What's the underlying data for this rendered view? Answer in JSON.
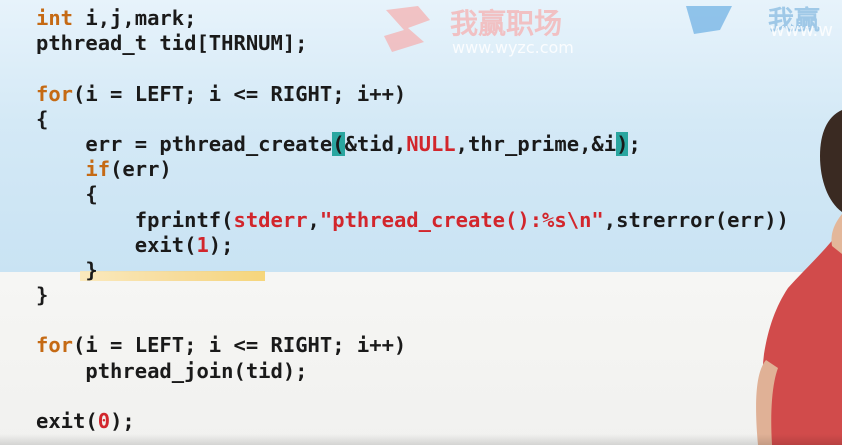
{
  "watermarks": {
    "brand_cn": "我赢职场",
    "url": "www.wyzc.com",
    "brand_cn_partial": "我赢",
    "url_partial": "www.w"
  },
  "code": {
    "lines": [
      [
        {
          "t": "int",
          "c": "kw"
        },
        {
          "t": " i,j,mark;",
          "c": "tok"
        }
      ],
      [
        {
          "t": "pthread_t tid[THRNUM];",
          "c": "tok"
        }
      ],
      [
        {
          "t": "",
          "c": "tok"
        }
      ],
      [
        {
          "t": "for",
          "c": "kw"
        },
        {
          "t": "(i = LEFT; i <= RIGHT; i++)",
          "c": "tok"
        }
      ],
      [
        {
          "t": "{",
          "c": "tok"
        }
      ],
      [
        {
          "t": "    err = pthread_create",
          "c": "tok"
        },
        {
          "t": "(",
          "c": "paren"
        },
        {
          "t": "&tid,",
          "c": "tok"
        },
        {
          "t": "NULL",
          "c": "red"
        },
        {
          "t": ",thr_prime,&i",
          "c": "tok"
        },
        {
          "t": ")",
          "c": "paren"
        },
        {
          "t": ";",
          "c": "tok"
        }
      ],
      [
        {
          "t": "    ",
          "c": "tok"
        },
        {
          "t": "if",
          "c": "kw"
        },
        {
          "t": "(err)",
          "c": "tok"
        }
      ],
      [
        {
          "t": "    {",
          "c": "tok"
        }
      ],
      [
        {
          "t": "        fprintf(",
          "c": "tok"
        },
        {
          "t": "stderr",
          "c": "red"
        },
        {
          "t": ",",
          "c": "tok"
        },
        {
          "t": "\"pthread_create():%s\\n\"",
          "c": "red"
        },
        {
          "t": ",strerror(err))",
          "c": "tok"
        }
      ],
      [
        {
          "t": "        exit(",
          "c": "tok"
        },
        {
          "t": "1",
          "c": "red"
        },
        {
          "t": ");",
          "c": "tok"
        }
      ],
      [
        {
          "t": "    }",
          "c": "tok"
        }
      ],
      [
        {
          "t": "}",
          "c": "tok"
        }
      ],
      [
        {
          "t": "",
          "c": "tok"
        }
      ],
      [
        {
          "t": "for",
          "c": "kw"
        },
        {
          "t": "(i = LEFT; i <= RIGHT; i++)",
          "c": "tok"
        }
      ],
      [
        {
          "t": "    pthread_join(tid);",
          "c": "tok"
        }
      ],
      [
        {
          "t": "",
          "c": "tok"
        }
      ],
      [
        {
          "t": "exit(",
          "c": "tok"
        },
        {
          "t": "0",
          "c": "red"
        },
        {
          "t": ");",
          "c": "tok"
        }
      ]
    ]
  }
}
